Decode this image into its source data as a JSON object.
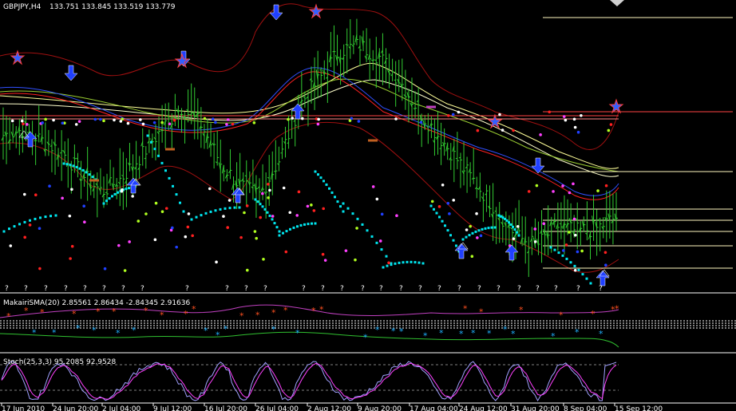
{
  "window": {
    "symbol_label": "GBPJPY,H4",
    "ohlc_label": "133.751 133.845 133.519 133.779"
  },
  "chart_data": [
    {
      "type": "line",
      "pane": "price",
      "title": "GBPJPY,H4  133.751 133.845 133.519 133.779",
      "x_labels": [
        "17 Jun 2010",
        "24 Jun 20:00",
        "2 Jul 04:00",
        "9 Jul 12:00",
        "16 Jul 20:00",
        "26 Jul 04:00",
        "2 Aug 12:00",
        "9 Aug 20:00",
        "17 Aug 04:00",
        "24 Aug 12:00",
        "31 Aug 20:00",
        "8 Sep 04:00",
        "15 Sep 12:00"
      ],
      "close_approx": [
        136.6,
        136.8,
        136.4,
        136.0,
        135.2,
        134.6,
        135.1,
        135.9,
        136.8,
        137.6,
        137.0,
        135.6,
        134.8,
        134.5,
        135.8,
        137.7,
        138.6,
        139.6,
        139.8,
        139.4,
        138.6,
        137.5,
        136.6,
        135.7,
        134.8,
        133.9,
        133.0,
        132.7,
        133.4,
        133.2,
        133.3,
        133.7
      ],
      "grid": false,
      "legend": "none",
      "colors": {
        "background": "#000000",
        "up_bar": "#32cd32",
        "ma_yellow": "#ffff99",
        "ma_red": "#ff2020",
        "band": "#aa1111",
        "psar": "#00e5ee"
      }
    },
    {
      "type": "line",
      "pane": "indicator",
      "title": "MakairiSMA(20) 2.85561 2.86434 -2.84345 2.91636",
      "values": [
        2.85561,
        2.86434,
        -2.84345,
        2.91636
      ],
      "grid": false
    },
    {
      "type": "line",
      "pane": "oscillator",
      "title": "Stoch(25,3,3) 95.2085 92.9528",
      "values": [
        95.2085,
        92.9528
      ],
      "ylim": [
        0,
        100
      ],
      "grid": false
    }
  ],
  "indicator_label": "MakairiSMA(20) 2.85561 2.86434 -2.84345 2.91636",
  "stoch_label": "Stoch(25,3,3) 95.2085 92.9528",
  "fractal_mark": "?",
  "colors": {
    "background": "#000000",
    "axis_text": "#ffffff",
    "separator": "#ffffff",
    "price_line": "#ff4444",
    "hline": "#fff8c0",
    "stoch_main": "#a0a0ff",
    "stoch_signal": "#ff40ff"
  }
}
